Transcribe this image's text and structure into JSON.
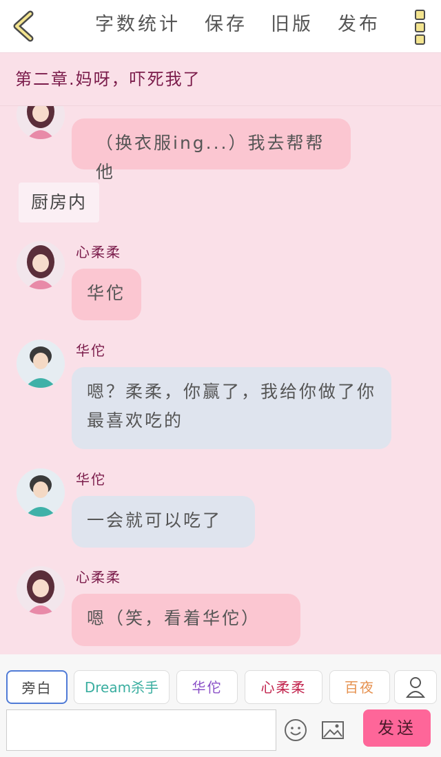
{
  "header": {
    "actions": [
      "字数统计",
      "保存",
      "旧版",
      "发布"
    ]
  },
  "chapter": {
    "title": "第二章.妈呀，吓死我了"
  },
  "messages": [
    {
      "text": "（换衣服ing...）我去帮帮他"
    },
    {
      "scene": "厨房内"
    },
    {
      "speaker": "心柔柔",
      "text": "华佗"
    },
    {
      "speaker": "华佗",
      "text": "嗯？柔柔，你赢了，我给你做了你最喜欢吃的"
    },
    {
      "speaker": "华佗",
      "text": "一会就可以吃了"
    },
    {
      "speaker": "心柔柔",
      "text": "嗯（笑，看着华佗）"
    }
  ],
  "roles": [
    {
      "label": "旁白",
      "color": "#444444"
    },
    {
      "label": "Dream杀手",
      "color": "#3aaea0"
    },
    {
      "label": "华佗",
      "color": "#8a4fc7"
    },
    {
      "label": "心柔柔",
      "color": "#c2254e"
    },
    {
      "label": "百夜",
      "color": "#e6914f"
    }
  ],
  "composer": {
    "input_value": "",
    "send_label": "发送"
  },
  "icons": {
    "back": "chevron-left-icon",
    "more": "more-vertical-icon",
    "user": "user-icon",
    "emoji": "emoji-icon",
    "image": "image-icon"
  }
}
